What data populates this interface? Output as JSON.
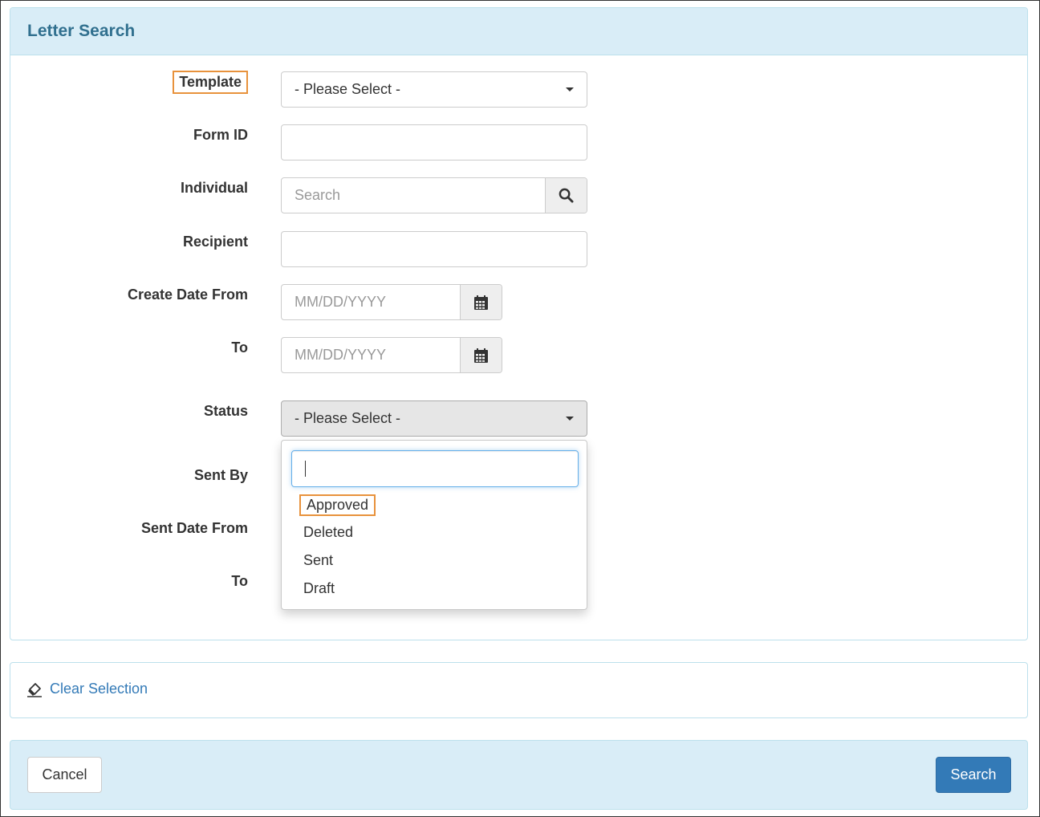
{
  "panel": {
    "title": "Letter Search"
  },
  "form": {
    "template": {
      "label": "Template",
      "value": "- Please Select -"
    },
    "form_id": {
      "label": "Form ID",
      "value": ""
    },
    "individual": {
      "label": "Individual",
      "placeholder": "Search"
    },
    "recipient": {
      "label": "Recipient",
      "value": ""
    },
    "create_date_from": {
      "label": "Create Date From",
      "placeholder": "MM/DD/YYYY"
    },
    "create_date_to": {
      "label": "To",
      "placeholder": "MM/DD/YYYY"
    },
    "status": {
      "label": "Status",
      "value": "- Please Select -"
    },
    "sent_by": {
      "label": "Sent By"
    },
    "sent_date_from": {
      "label": "Sent Date From"
    },
    "sent_date_to": {
      "label": "To"
    }
  },
  "status_dropdown": {
    "search_value": "",
    "options": [
      "Approved",
      "Deleted",
      "Sent",
      "Draft"
    ]
  },
  "actions": {
    "clear_selection": "Clear Selection",
    "cancel": "Cancel",
    "search": "Search"
  },
  "colors": {
    "accent": "#337ab7",
    "panel_heading_bg": "#d9edf7",
    "panel_title": "#31708f",
    "highlight": "#e8923c"
  }
}
